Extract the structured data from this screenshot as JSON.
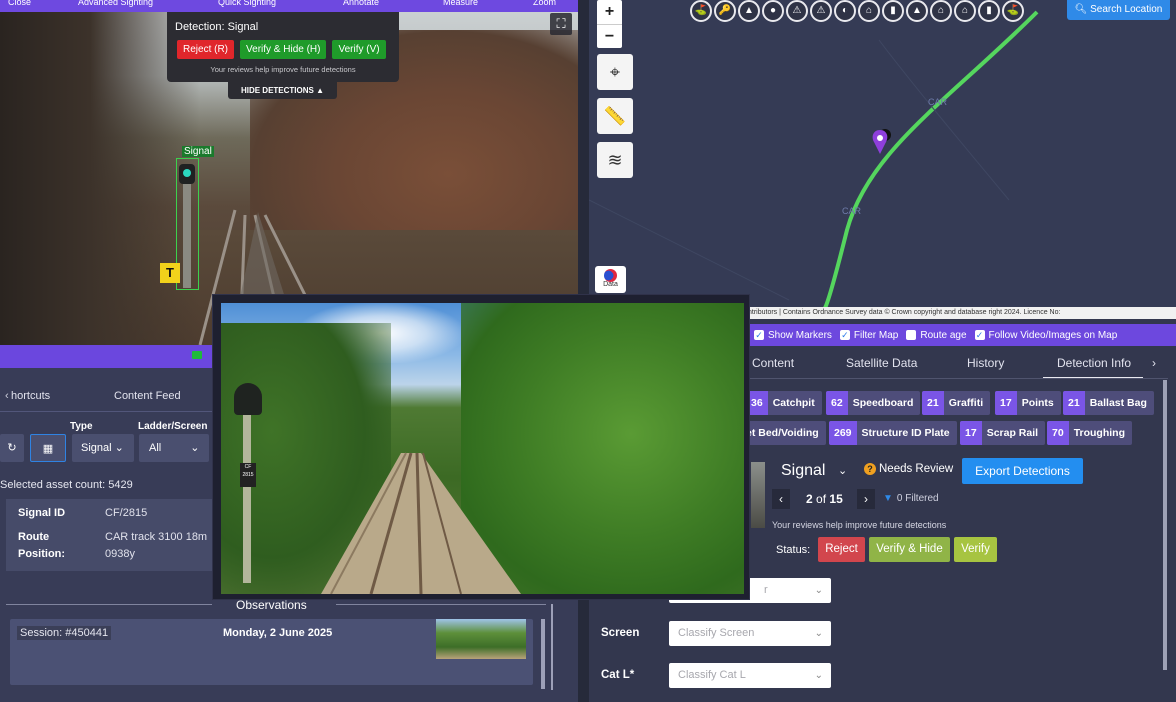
{
  "toolbar": {
    "items": [
      "Close",
      "Advanced Sighting",
      "Quick Sighting",
      "Annotate",
      "Measure",
      "Zoom"
    ]
  },
  "detection_popup": {
    "title": "Detection: Signal",
    "reject": "Reject (R)",
    "verify_hide": "Verify & Hide (H)",
    "verify": "Verify (V)",
    "note": "Your reviews help improve future detections",
    "hide_detections": "HIDE DETECTIONS"
  },
  "video": {
    "signal_tag": "Signal",
    "t_sign": "T"
  },
  "left_panel": {
    "tabs": [
      "hortcuts",
      "Content Feed"
    ],
    "type_label": "Type",
    "ladder_label": "Ladder/Screen",
    "type_value": "Signal",
    "ladder_value": "All",
    "asset_count": "Selected asset count: 5429",
    "signal_id_label": "Signal ID",
    "signal_id_value": "CF/2815",
    "route_label": "Route",
    "position_label": "Position:",
    "route_value": "CAR track 3100 18m",
    "position_value": "0938y",
    "observations_title": "Observations",
    "session": "Session: #450441",
    "session_date": "Monday, 2 June 2025"
  },
  "float_image": {
    "plate_line1": "CF",
    "plate_line2": "2815"
  },
  "map": {
    "search_location": "Search Location",
    "zoom_in": "+",
    "zoom_out": "−",
    "label_car_1": "CAR",
    "label_car_2": "CAR",
    "data_btn": "Data",
    "attribution": "ntributors | Contains Ordnance Survey data © Crown copyright and database right 2024. Licence No:",
    "icons": [
      "⛳",
      "🔑",
      "▲",
      "●",
      "⚠",
      "⚠",
      "◐",
      "⌂",
      "▮",
      "▲",
      "⌂",
      "⌂",
      "▮",
      "⛳"
    ]
  },
  "filters": {
    "show_markers": "Show Markers",
    "filter_map": "Filter Map",
    "route_age": "Route age",
    "follow_video": "Follow Video/Images on Map"
  },
  "right_tabs": [
    "Content",
    "Satellite Data",
    "History",
    "Detection Info"
  ],
  "chips": [
    {
      "n": "36",
      "label": "Catchpit"
    },
    {
      "n": "62",
      "label": "Speedboard"
    },
    {
      "n": "21",
      "label": "Graffiti"
    },
    {
      "n": "17",
      "label": "Points"
    },
    {
      "n": "21",
      "label": "Ballast Bag"
    },
    {
      "n": "",
      "label": "et Bed/Voiding"
    },
    {
      "n": "269",
      "label": "Structure ID Plate"
    },
    {
      "n": "17",
      "label": "Scrap Rail"
    },
    {
      "n": "70",
      "label": "Troughing"
    }
  ],
  "detection_info": {
    "asset_type": "Signal",
    "needs_review": "Needs Review",
    "export": "Export Detections",
    "pager_current": "2",
    "pager_of": "of",
    "pager_total": "15",
    "filtered": "0 Filtered",
    "note": "Your reviews help improve future detections",
    "status_label": "Status:",
    "reject": "Reject",
    "verify_hide": "Verify & Hide",
    "verify": "Verify"
  },
  "form": {
    "field1_placeholder": "r",
    "screen_label": "Screen",
    "screen_placeholder": "Classify Screen",
    "catl_label": "Cat L*",
    "catl_placeholder": "Classify Cat L"
  },
  "colors": {
    "accent": "#6d48de",
    "primary_blue": "#238ef0",
    "reject_red": "#d2464d",
    "verify_green": "#a7c441",
    "track_line": "#55d65e"
  }
}
